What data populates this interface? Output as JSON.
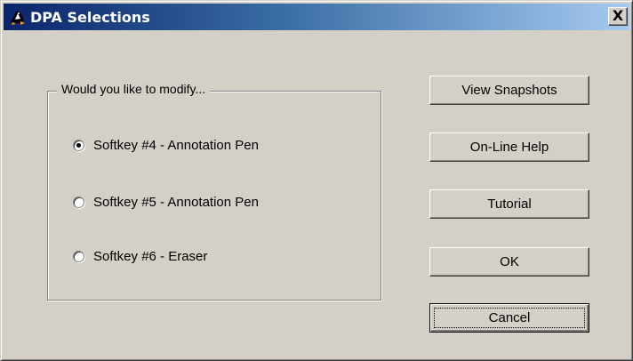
{
  "window": {
    "title": "DPA Selections",
    "icon": "penguin-icon",
    "close_label": "X"
  },
  "group": {
    "legend": "Would you like to modify...",
    "options": [
      {
        "label": "Softkey #4 - Annotation Pen",
        "checked": true
      },
      {
        "label": "Softkey #5 - Annotation Pen",
        "checked": false
      },
      {
        "label": "Softkey #6 - Eraser",
        "checked": false
      }
    ]
  },
  "buttons": {
    "view_snapshots": "View Snapshots",
    "online_help": "On-Line Help",
    "tutorial": "Tutorial",
    "ok": "OK",
    "cancel": "Cancel"
  },
  "colors": {
    "face": "#d4d0c8",
    "title_start": "#0a246a",
    "title_end": "#a6caf0"
  }
}
